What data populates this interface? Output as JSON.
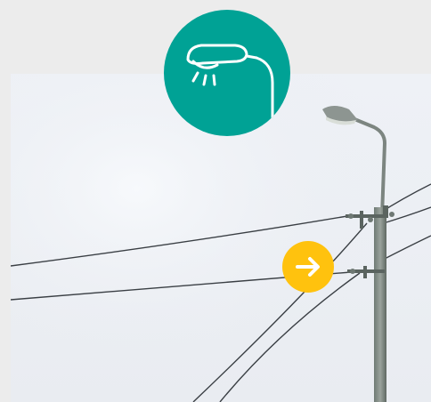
{
  "colors": {
    "background": "#ececec",
    "badge": "#00a295",
    "badge_icon": "#ffffff",
    "button": "#ffc20e",
    "button_icon": "#ffffff"
  },
  "badge": {
    "icon": "street-lamp-icon"
  },
  "photo": {
    "subject": "street-light-pole-photo"
  },
  "next_button": {
    "icon": "arrow-right-icon"
  }
}
